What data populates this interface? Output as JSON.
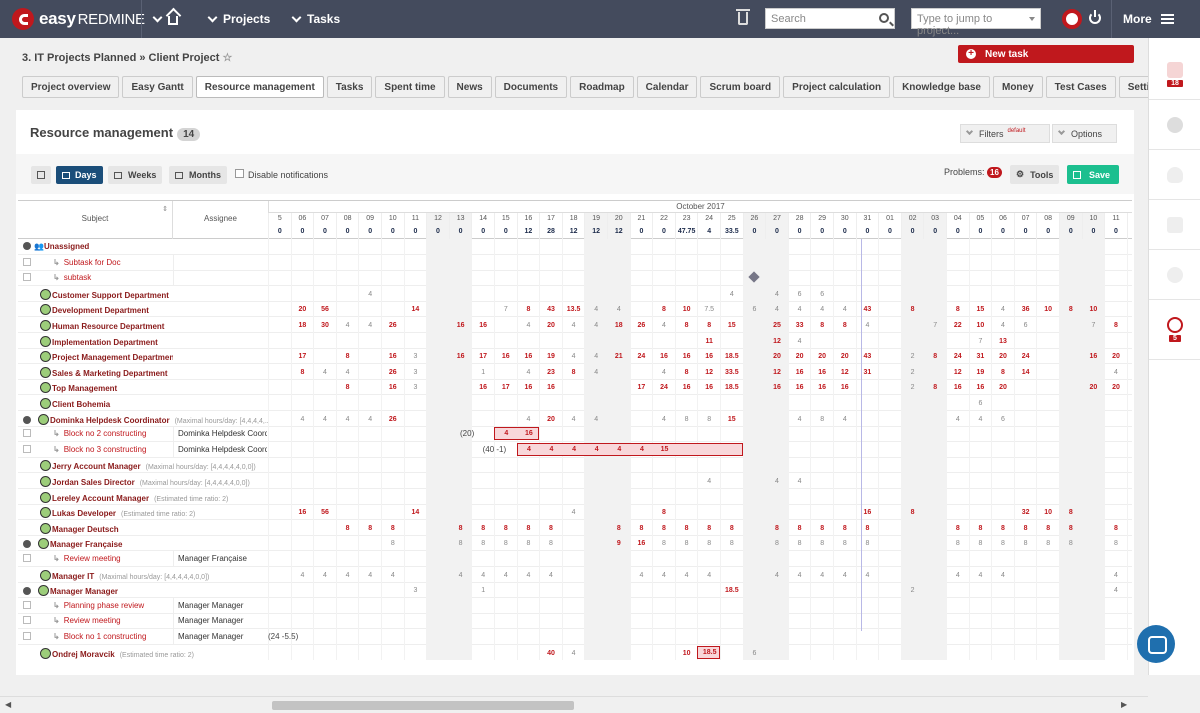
{
  "topbar": {
    "logo_easy": "easy",
    "logo_redmine": "REDMINE",
    "projects_label": "Projects",
    "tasks_label": "Tasks",
    "search_placeholder": "Search",
    "jump_placeholder": "Type to jump to project...",
    "more_label": "More"
  },
  "breadcrumb": "3. IT Projects Planned » Client Project",
  "new_task_label": "New task",
  "tabs": [
    "Project overview",
    "Easy Gantt",
    "Resource management",
    "Tasks",
    "Spent time",
    "News",
    "Documents",
    "Roadmap",
    "Calendar",
    "Scrum board",
    "Project calculation",
    "Knowledge base",
    "Money",
    "Test Cases",
    "Settings"
  ],
  "active_tab": "Resource management",
  "panel": {
    "title": "Resource management",
    "count": "14",
    "filters_label": "Filters",
    "filters_default": "default",
    "options_label": "Options"
  },
  "toolbar": {
    "days": "Days",
    "weeks": "Weeks",
    "months": "Months",
    "disable_notifications": "Disable notifications",
    "problems_label": "Problems:",
    "problems_count": "16",
    "tools": "Tools",
    "save": "Save"
  },
  "grid": {
    "month_label": "October 2017",
    "subject_header": "Subject",
    "assignee_header": "Assignee",
    "days": [
      "5",
      "06",
      "07",
      "08",
      "09",
      "10",
      "11",
      "12",
      "13",
      "14",
      "15",
      "16",
      "17",
      "18",
      "19",
      "20",
      "21",
      "22",
      "23",
      "24",
      "25",
      "26",
      "27",
      "28",
      "29",
      "30",
      "31",
      "01",
      "02",
      "03",
      "04",
      "05",
      "06",
      "07",
      "08",
      "09",
      "10",
      "11",
      "12"
    ],
    "weekend_cols": [
      7,
      8,
      14,
      15,
      21,
      22,
      28,
      29,
      35,
      36
    ],
    "totals": [
      "0",
      "0",
      "0",
      "0",
      "0",
      "0",
      "0",
      "0",
      "0",
      "0",
      "0",
      "12",
      "28",
      "12",
      "12",
      "12",
      "0",
      "0",
      "47.75",
      "4",
      "33.5",
      "0",
      "0",
      "0",
      "0",
      "0",
      "0",
      "0",
      "0",
      "0",
      "0",
      "0",
      "0",
      "0",
      "0",
      "0",
      "0",
      "0",
      "0"
    ],
    "rows": [
      {
        "subject": "Unassigned",
        "kind": "group",
        "cells": {}
      },
      {
        "subject": "Subtask for Doc",
        "kind": "task",
        "assignee": "",
        "cells": {}
      },
      {
        "subject": "subtask",
        "kind": "task",
        "assignee": "",
        "cells": {}
      },
      {
        "subject": "Customer Support Department",
        "kind": "user",
        "cells": {
          "4": "4",
          "20": "4",
          "22": "4",
          "23": "6",
          "24": "6"
        }
      },
      {
        "subject": "Development Department",
        "kind": "user",
        "cells": {
          "1": "20",
          "2": "56",
          "6": "14",
          "10": "7",
          "11": "8",
          "12": "43",
          "13": "13.5",
          "14": "4",
          "15": "4",
          "17": "8",
          "18": "10",
          "19": "7.5",
          "21": "6",
          "22": "4",
          "23": "4",
          "24": "4",
          "25": "4",
          "26": "43",
          "28": "8",
          "30": "8",
          "31": "15",
          "32": "4",
          "33": "36",
          "34": "10",
          "35": "8",
          "36": "10"
        }
      },
      {
        "subject": "Human Resource Department",
        "kind": "user",
        "cells": {
          "1": "18",
          "2": "30",
          "3": "4",
          "4": "4",
          "5": "26",
          "8": "16",
          "9": "16",
          "11": "4",
          "12": "20",
          "13": "4",
          "14": "4",
          "15": "18",
          "16": "26",
          "17": "4",
          "18": "8",
          "19": "8",
          "20": "15",
          "22": "25",
          "23": "33",
          "24": "8",
          "25": "8",
          "26": "4",
          "29": "7",
          "30": "22",
          "31": "10",
          "32": "4",
          "33": "6",
          "36": "7",
          "37": "8"
        }
      },
      {
        "subject": "Implementation Department",
        "kind": "user",
        "cells": {
          "19": "11",
          "22": "12",
          "23": "4",
          "31": "7",
          "32": "13"
        }
      },
      {
        "subject": "Project Management Department",
        "kind": "user",
        "cells": {
          "1": "17",
          "3": "8",
          "5": "16",
          "6": "3",
          "8": "16",
          "9": "17",
          "10": "16",
          "11": "16",
          "12": "19",
          "13": "4",
          "14": "4",
          "15": "21",
          "16": "24",
          "17": "16",
          "18": "16",
          "19": "16",
          "20": "18.5",
          "22": "20",
          "23": "20",
          "24": "20",
          "25": "20",
          "26": "43",
          "28": "2",
          "29": "8",
          "30": "24",
          "31": "31",
          "32": "20",
          "33": "24",
          "36": "16",
          "37": "20",
          "38": "20"
        }
      },
      {
        "subject": "Sales & Marketing Department",
        "kind": "user",
        "cells": {
          "1": "8",
          "2": "4",
          "3": "4",
          "5": "26",
          "6": "3",
          "9": "1",
          "11": "4",
          "12": "23",
          "13": "8",
          "14": "4",
          "17": "4",
          "18": "8",
          "19": "12",
          "20": "33.5",
          "22": "12",
          "23": "16",
          "24": "16",
          "25": "12",
          "26": "31",
          "28": "2",
          "30": "12",
          "31": "19",
          "32": "8",
          "33": "14",
          "37": "4",
          "38": "4"
        }
      },
      {
        "subject": "Top Management",
        "kind": "user",
        "cells": {
          "3": "8",
          "5": "16",
          "6": "3",
          "9": "16",
          "10": "17",
          "11": "16",
          "12": "16",
          "16": "17",
          "17": "24",
          "18": "16",
          "19": "16",
          "20": "18.5",
          "22": "16",
          "23": "16",
          "24": "16",
          "25": "16",
          "28": "2",
          "29": "8",
          "30": "16",
          "31": "16",
          "32": "20",
          "36": "20",
          "37": "20",
          "38": "20"
        }
      },
      {
        "subject": "Client Bohemia",
        "kind": "user",
        "cells": {
          "31": "6"
        }
      },
      {
        "subject": "Dominka Helpdesk Coordinator",
        "kind": "user-group",
        "meta": "(Maximal hours/day: [4,4,4,4,...",
        "cells": {
          "1": "4",
          "2": "4",
          "3": "4",
          "4": "4",
          "5": "26",
          "11": "4",
          "12": "20",
          "13": "4",
          "14": "4",
          "17": "4",
          "18": "8",
          "19": "8",
          "20": "15",
          "23": "4",
          "24": "8",
          "25": "4",
          "30": "4",
          "31": "4",
          "32": "6"
        }
      },
      {
        "subject": "Block no 2 constructing",
        "kind": "task",
        "assignee": "Dominka Helpdesk Coord",
        "note": "(20)",
        "cells": {}
      },
      {
        "subject": "Block no 3 constructing",
        "kind": "task",
        "assignee": "Dominka Helpdesk Coord",
        "note": "(40 -1)",
        "cells": {}
      },
      {
        "subject": "Jerry Account Manager",
        "kind": "user",
        "meta": "(Maximal hours/day: [4,4,4,4,4,0,0])",
        "cells": {}
      },
      {
        "subject": "Jordan Sales Director",
        "kind": "user",
        "meta": "(Maximal hours/day: [4,4,4,4,4,0,0])",
        "cells": {
          "19": "4",
          "22": "4",
          "23": "4"
        }
      },
      {
        "subject": "Lereley Account Manager",
        "kind": "user",
        "meta": "(Estimated time ratio: 2)",
        "cells": {}
      },
      {
        "subject": "Lukas Developer",
        "kind": "user",
        "meta": "(Estimated time ratio: 2)",
        "cells": {
          "1": "16",
          "2": "56",
          "6": "14",
          "13": "4",
          "17": "8",
          "26": "16",
          "28": "8",
          "33": "32",
          "34": "10",
          "35": "8"
        }
      },
      {
        "subject": "Manager Deutsch",
        "kind": "user",
        "cells": {
          "3": "8",
          "4": "8",
          "5": "8",
          "8": "8",
          "9": "8",
          "10": "8",
          "11": "8",
          "12": "8",
          "15": "8",
          "16": "8",
          "17": "8",
          "18": "8",
          "19": "8",
          "20": "8",
          "22": "8",
          "23": "8",
          "24": "8",
          "25": "8",
          "26": "8",
          "30": "8",
          "31": "8",
          "32": "8",
          "33": "8",
          "34": "8",
          "35": "8",
          "37": "8",
          "38": "8"
        }
      },
      {
        "subject": "Manager Française",
        "kind": "user-group",
        "cells": {
          "5": "8",
          "8": "8",
          "9": "8",
          "10": "8",
          "11": "8",
          "12": "8",
          "15": "9",
          "16": "16",
          "17": "8",
          "18": "8",
          "19": "8",
          "20": "8",
          "22": "8",
          "23": "8",
          "24": "8",
          "25": "8",
          "26": "8",
          "30": "8",
          "31": "8",
          "32": "8",
          "33": "8",
          "34": "8",
          "35": "8",
          "37": "8",
          "38": "8"
        }
      },
      {
        "subject": "Review meeting",
        "kind": "task",
        "assignee": "Manager Française",
        "cells": {}
      },
      {
        "subject": "Manager IT",
        "kind": "user",
        "meta": "(Maximal hours/day: [4,4,4,4,4,0,0])",
        "cells": {
          "1": "4",
          "2": "4",
          "3": "4",
          "4": "4",
          "5": "4",
          "8": "4",
          "9": "4",
          "10": "4",
          "11": "4",
          "12": "4",
          "16": "4",
          "17": "4",
          "18": "4",
          "19": "4",
          "22": "4",
          "23": "4",
          "24": "4",
          "25": "4",
          "26": "4",
          "30": "4",
          "31": "4",
          "32": "4",
          "37": "4",
          "38": "4"
        }
      },
      {
        "subject": "Manager Manager",
        "kind": "user-group",
        "cells": {
          "6": "3",
          "9": "1",
          "20": "18.5",
          "28": "2",
          "37": "4",
          "38": "4"
        }
      },
      {
        "subject": "Planning phase review",
        "kind": "task",
        "assignee": "Manager Manager",
        "cells": {}
      },
      {
        "subject": "Review meeting",
        "kind": "task",
        "assignee": "Manager Manager",
        "cells": {}
      },
      {
        "subject": "Block no 1 constructing",
        "kind": "task",
        "assignee": "Manager Manager",
        "note": "(24 -5.5)",
        "cells": {}
      },
      {
        "subject": "Ondrej Moravcik",
        "kind": "user",
        "meta": "(Estimated time ratio: 2)",
        "cells": {
          "12": "40",
          "13": "4",
          "18": "10",
          "21": "6"
        }
      }
    ],
    "bars": [
      {
        "row": 12,
        "from": 10,
        "to": 11,
        "values": [
          "4",
          "16"
        ]
      },
      {
        "row": 13,
        "from": 11,
        "to": 20,
        "values": [
          "4",
          "4",
          "4",
          "4",
          "4",
          "4",
          "15"
        ]
      },
      {
        "row": 26,
        "from": 19,
        "to": 19,
        "values": [
          "18.5"
        ]
      }
    ],
    "milestone": {
      "row": 2,
      "col": 21
    }
  },
  "sidebar": {
    "badge_top": "18",
    "badge_bottom": "5"
  }
}
